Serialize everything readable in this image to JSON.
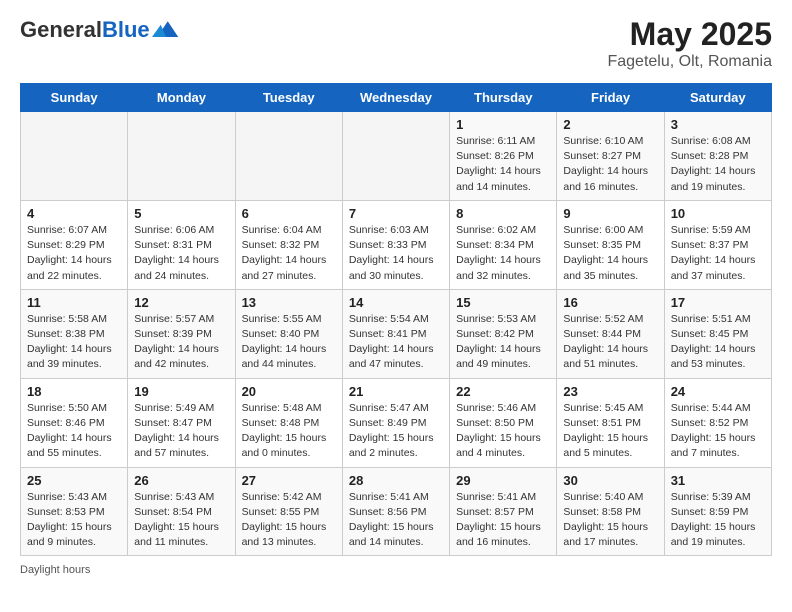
{
  "header": {
    "logo_general": "General",
    "logo_blue": "Blue",
    "title": "May 2025",
    "location": "Fagetelu, Olt, Romania"
  },
  "days_of_week": [
    "Sunday",
    "Monday",
    "Tuesday",
    "Wednesday",
    "Thursday",
    "Friday",
    "Saturday"
  ],
  "weeks": [
    [
      {
        "day": "",
        "info": ""
      },
      {
        "day": "",
        "info": ""
      },
      {
        "day": "",
        "info": ""
      },
      {
        "day": "",
        "info": ""
      },
      {
        "day": "1",
        "info": "Sunrise: 6:11 AM\nSunset: 8:26 PM\nDaylight: 14 hours\nand 14 minutes."
      },
      {
        "day": "2",
        "info": "Sunrise: 6:10 AM\nSunset: 8:27 PM\nDaylight: 14 hours\nand 16 minutes."
      },
      {
        "day": "3",
        "info": "Sunrise: 6:08 AM\nSunset: 8:28 PM\nDaylight: 14 hours\nand 19 minutes."
      }
    ],
    [
      {
        "day": "4",
        "info": "Sunrise: 6:07 AM\nSunset: 8:29 PM\nDaylight: 14 hours\nand 22 minutes."
      },
      {
        "day": "5",
        "info": "Sunrise: 6:06 AM\nSunset: 8:31 PM\nDaylight: 14 hours\nand 24 minutes."
      },
      {
        "day": "6",
        "info": "Sunrise: 6:04 AM\nSunset: 8:32 PM\nDaylight: 14 hours\nand 27 minutes."
      },
      {
        "day": "7",
        "info": "Sunrise: 6:03 AM\nSunset: 8:33 PM\nDaylight: 14 hours\nand 30 minutes."
      },
      {
        "day": "8",
        "info": "Sunrise: 6:02 AM\nSunset: 8:34 PM\nDaylight: 14 hours\nand 32 minutes."
      },
      {
        "day": "9",
        "info": "Sunrise: 6:00 AM\nSunset: 8:35 PM\nDaylight: 14 hours\nand 35 minutes."
      },
      {
        "day": "10",
        "info": "Sunrise: 5:59 AM\nSunset: 8:37 PM\nDaylight: 14 hours\nand 37 minutes."
      }
    ],
    [
      {
        "day": "11",
        "info": "Sunrise: 5:58 AM\nSunset: 8:38 PM\nDaylight: 14 hours\nand 39 minutes."
      },
      {
        "day": "12",
        "info": "Sunrise: 5:57 AM\nSunset: 8:39 PM\nDaylight: 14 hours\nand 42 minutes."
      },
      {
        "day": "13",
        "info": "Sunrise: 5:55 AM\nSunset: 8:40 PM\nDaylight: 14 hours\nand 44 minutes."
      },
      {
        "day": "14",
        "info": "Sunrise: 5:54 AM\nSunset: 8:41 PM\nDaylight: 14 hours\nand 47 minutes."
      },
      {
        "day": "15",
        "info": "Sunrise: 5:53 AM\nSunset: 8:42 PM\nDaylight: 14 hours\nand 49 minutes."
      },
      {
        "day": "16",
        "info": "Sunrise: 5:52 AM\nSunset: 8:44 PM\nDaylight: 14 hours\nand 51 minutes."
      },
      {
        "day": "17",
        "info": "Sunrise: 5:51 AM\nSunset: 8:45 PM\nDaylight: 14 hours\nand 53 minutes."
      }
    ],
    [
      {
        "day": "18",
        "info": "Sunrise: 5:50 AM\nSunset: 8:46 PM\nDaylight: 14 hours\nand 55 minutes."
      },
      {
        "day": "19",
        "info": "Sunrise: 5:49 AM\nSunset: 8:47 PM\nDaylight: 14 hours\nand 57 minutes."
      },
      {
        "day": "20",
        "info": "Sunrise: 5:48 AM\nSunset: 8:48 PM\nDaylight: 15 hours\nand 0 minutes."
      },
      {
        "day": "21",
        "info": "Sunrise: 5:47 AM\nSunset: 8:49 PM\nDaylight: 15 hours\nand 2 minutes."
      },
      {
        "day": "22",
        "info": "Sunrise: 5:46 AM\nSunset: 8:50 PM\nDaylight: 15 hours\nand 4 minutes."
      },
      {
        "day": "23",
        "info": "Sunrise: 5:45 AM\nSunset: 8:51 PM\nDaylight: 15 hours\nand 5 minutes."
      },
      {
        "day": "24",
        "info": "Sunrise: 5:44 AM\nSunset: 8:52 PM\nDaylight: 15 hours\nand 7 minutes."
      }
    ],
    [
      {
        "day": "25",
        "info": "Sunrise: 5:43 AM\nSunset: 8:53 PM\nDaylight: 15 hours\nand 9 minutes."
      },
      {
        "day": "26",
        "info": "Sunrise: 5:43 AM\nSunset: 8:54 PM\nDaylight: 15 hours\nand 11 minutes."
      },
      {
        "day": "27",
        "info": "Sunrise: 5:42 AM\nSunset: 8:55 PM\nDaylight: 15 hours\nand 13 minutes."
      },
      {
        "day": "28",
        "info": "Sunrise: 5:41 AM\nSunset: 8:56 PM\nDaylight: 15 hours\nand 14 minutes."
      },
      {
        "day": "29",
        "info": "Sunrise: 5:41 AM\nSunset: 8:57 PM\nDaylight: 15 hours\nand 16 minutes."
      },
      {
        "day": "30",
        "info": "Sunrise: 5:40 AM\nSunset: 8:58 PM\nDaylight: 15 hours\nand 17 minutes."
      },
      {
        "day": "31",
        "info": "Sunrise: 5:39 AM\nSunset: 8:59 PM\nDaylight: 15 hours\nand 19 minutes."
      }
    ]
  ],
  "footer": {
    "note": "Daylight hours"
  }
}
